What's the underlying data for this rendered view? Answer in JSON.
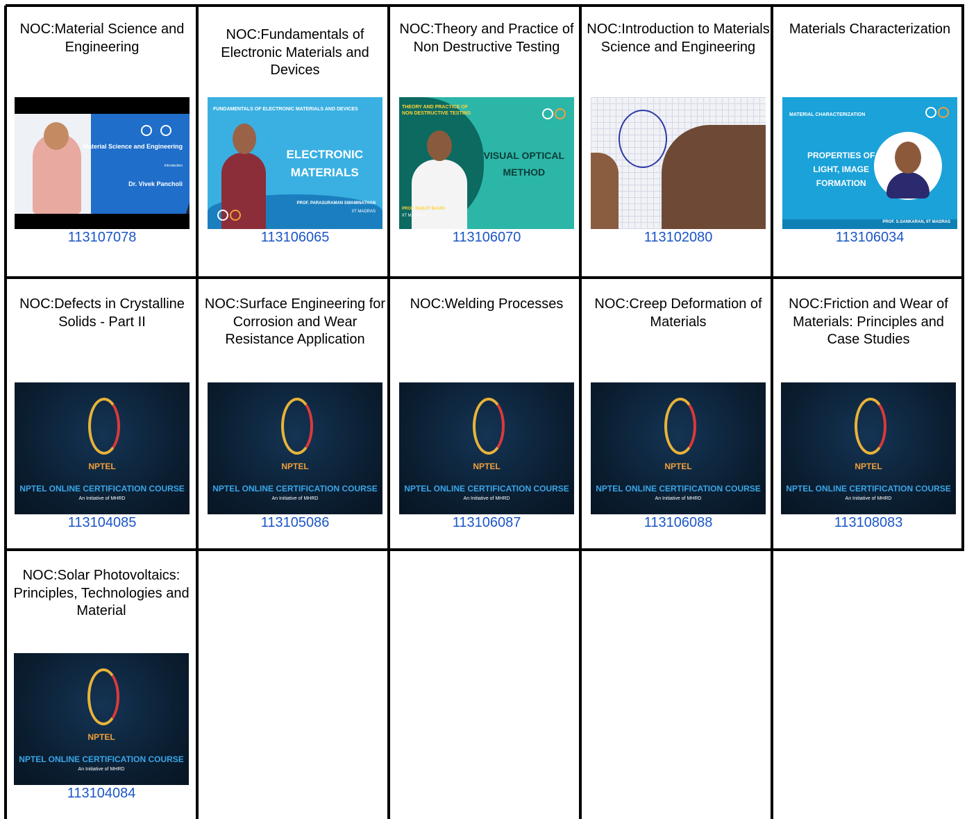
{
  "courses": [
    {
      "title": "NOC:Material Science and Engineering",
      "code": "113107078",
      "thumb": {
        "name": "Dr. Vivek Pancholi",
        "subject": "Material Science and Engineering",
        "caption": "Introduction"
      }
    },
    {
      "title": "NOC:Fundamentals of Electronic Materials and Devices",
      "code": "113106065",
      "thumb": {
        "header": "FUNDAMENTALS OF ELECTRONIC MATERIALS AND DEVICES",
        "big1": "ELECTRONIC",
        "big2": "MATERIALS",
        "prof": "PROF. PARASURAMAN SWAMINATHAN",
        "inst": "IIT MADRAS"
      }
    },
    {
      "title": "NOC:Theory and Practice of Non Destructive Testing",
      "code": "113106070",
      "thumb": {
        "header1": "THEORY AND PRACTICE OF",
        "header2": "NON DESTRUCTIVE TESTING",
        "big1": "VISUAL OPTICAL",
        "big2": "METHOD",
        "prof": "PROF. RANJIT BAURI",
        "inst": "IIT MADRAS"
      }
    },
    {
      "title": "NOC:Introduction to Materials Science and Engineering",
      "code": "113102080",
      "thumb": {}
    },
    {
      "title": "Materials Characterization",
      "code": "113106034",
      "thumb": {
        "header": "MATERIAL CHARACTERIZATION",
        "big1": "PROPERTIES OF",
        "big2": "LIGHT, IMAGE",
        "big3": "FORMATION",
        "prof": "PROF. S.SANKARAN, IIT MADRAS"
      }
    },
    {
      "title": "NOC:Defects in Crystalline Solids - Part II",
      "code": "113104085"
    },
    {
      "title": "NOC:Surface Engineering for Corrosion and Wear Resistance Application",
      "code": "113105086"
    },
    {
      "title": "NOC:Welding Processes",
      "code": "113106087"
    },
    {
      "title": "NOC:Creep Deformation of Materials",
      "code": "113106088"
    },
    {
      "title": "NOC:Friction and Wear of Materials: Principles and Case Studies",
      "code": "113108083"
    },
    {
      "title": "NOC:Solar Photovoltaics: Principles, Technologies and Material",
      "code": "113104084"
    }
  ],
  "nptel_thumb": {
    "brand": "NPTEL",
    "course_line": "NPTEL ONLINE CERTIFICATION COURSE",
    "initiative": "An Initiative of MHRD"
  },
  "colors": {
    "link": "#1a55c7",
    "grid": "#000000"
  }
}
